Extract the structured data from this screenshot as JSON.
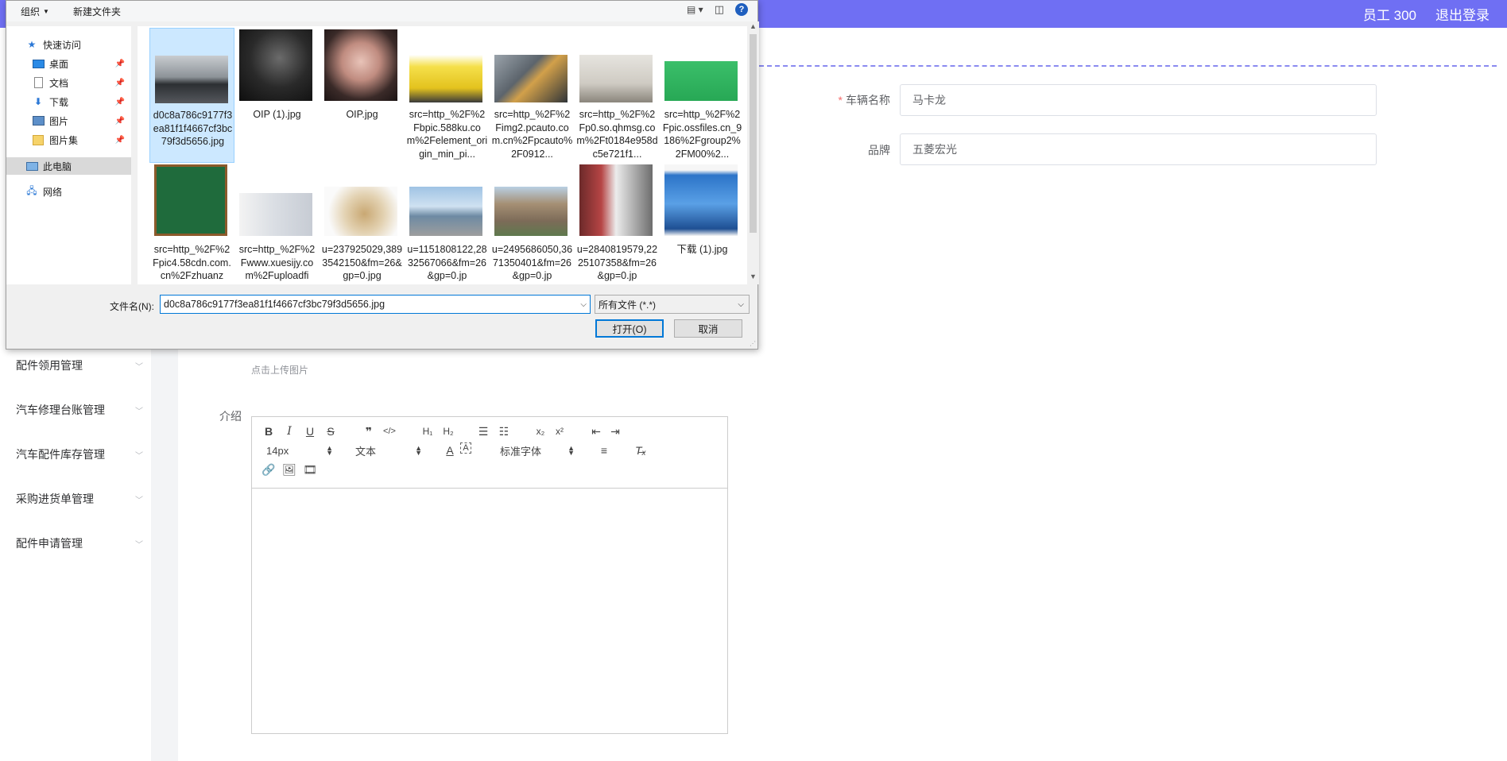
{
  "topbar": {
    "user": "员工 300",
    "logout": "退出登录"
  },
  "sidebar": {
    "items": [
      {
        "label": "配件领用管理"
      },
      {
        "label": "汽车修理台账管理"
      },
      {
        "label": "汽车配件库存管理"
      },
      {
        "label": "采购进货单管理"
      },
      {
        "label": "配件申请管理"
      }
    ]
  },
  "form": {
    "vehicle_name_label": "车辆名称",
    "vehicle_name_value": "马卡龙",
    "brand_label": "品牌",
    "brand_value": "五菱宏光",
    "upload_hint": "点击上传图片",
    "intro_label": "介绍"
  },
  "editor": {
    "toolbar_row1": [
      "B",
      "I",
      "U",
      "S",
      "❞",
      "</>",
      "H1",
      "H2",
      "ol",
      "ul",
      "x₂",
      "x²",
      "outdent",
      "indent"
    ],
    "font_size": "14px",
    "text_type": "文本",
    "font_family": "标准字体"
  },
  "dialog": {
    "toolbar": {
      "organize": "组织",
      "new_folder": "新建文件夹",
      "help": "?"
    },
    "nav": [
      {
        "label": "快速访问",
        "icon": "star-icon"
      },
      {
        "label": "桌面",
        "icon": "desktop-icon",
        "pinned": true
      },
      {
        "label": "文档",
        "icon": "document-icon",
        "pinned": true
      },
      {
        "label": "下载",
        "icon": "download-icon",
        "pinned": true
      },
      {
        "label": "图片",
        "icon": "pictures-icon",
        "pinned": true
      },
      {
        "label": "图片集",
        "icon": "folder-icon",
        "pinned": true
      },
      {
        "label": "此电脑",
        "icon": "computer-icon"
      },
      {
        "label": "网络",
        "icon": "network-icon"
      }
    ],
    "files": [
      {
        "name": "d0c8a786c9177f3ea81f1f4667cf3bc79f3d5656.jpg"
      },
      {
        "name": "OIP (1).jpg"
      },
      {
        "name": "OIP.jpg"
      },
      {
        "name": "src=http_%2F%2Fbpic.588ku.com%2Felement_origin_min_pi..."
      },
      {
        "name": "src=http_%2F%2Fimg2.pcauto.com.cn%2Fpcauto%2F0912..."
      },
      {
        "name": "src=http_%2F%2Fp0.so.qhmsg.com%2Ft0184e958dc5e721f1..."
      },
      {
        "name": "src=http_%2F%2Fpic.ossfiles.cn_9186%2Fgroup2%2FM00%2..."
      },
      {
        "name": "src=http_%2F%2Fpic4.58cdn.com.cn%2Fzhuanz"
      },
      {
        "name": "src=http_%2F%2Fwww.xuesijy.com%2Fuploadfi"
      },
      {
        "name": "u=237925029,3893542150&fm=26&gp=0.jpg"
      },
      {
        "name": "u=1151808122,2832567066&fm=26&gp=0.jp"
      },
      {
        "name": "u=2495686050,3671350401&fm=26&gp=0.jp"
      },
      {
        "name": "u=2840819579,2225107358&fm=26&gp=0.jp"
      },
      {
        "name": "下载 (1).jpg"
      }
    ],
    "filename_label": "文件名(N):",
    "filename_value": "d0c8a786c9177f3ea81f1f4667cf3bc79f3d5656.jpg",
    "filetype": "所有文件 (*.*)",
    "open_button": "打开(O)",
    "cancel_button": "取消"
  }
}
